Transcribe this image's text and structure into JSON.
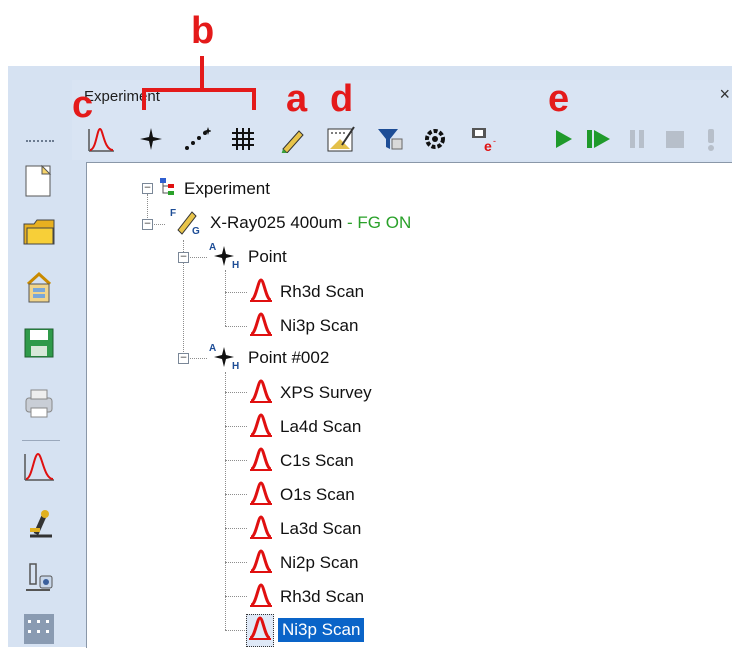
{
  "panel": {
    "title": "Experiment",
    "close_label": "×"
  },
  "annotations": {
    "a": "a",
    "b": "b",
    "c": "c",
    "d": "d",
    "e": "e"
  },
  "colors": {
    "annotation": "#e41a1a",
    "selection": "#0a64c8",
    "status_green": "#2aa12a",
    "peak_red": "#e01010"
  },
  "toolbar": {
    "icons": [
      "spectrum-icon",
      "point-icon",
      "line-icon",
      "grid-icon",
      "pen-icon",
      "image-icon",
      "filter-icon",
      "gear-icon",
      "camera-e-icon",
      "play-icon",
      "step-play-icon",
      "pause-icon",
      "stop-icon",
      "exclamation-icon"
    ]
  },
  "sidebar": {
    "icons": [
      "new-document-icon",
      "open-folder-icon",
      "import-icon",
      "save-icon",
      "print-icon",
      "spectrum-icon",
      "microscope-icon",
      "sample-icon",
      "grid-icon"
    ]
  },
  "tree": {
    "root": {
      "label": "Experiment"
    },
    "source": {
      "label": "X-Ray025 400um",
      "sep": " - ",
      "fg": "FG",
      "on": "ON"
    },
    "point1": {
      "label": "Point",
      "scans": [
        "Rh3d Scan",
        "Ni3p Scan"
      ]
    },
    "point2": {
      "label": "Point #002",
      "scans": [
        "XPS Survey",
        "La4d Scan",
        "C1s Scan",
        "O1s Scan",
        "La3d Scan",
        "Ni2p Scan",
        "Rh3d Scan",
        "Ni3p Scan"
      ]
    },
    "selected": "Ni3p Scan"
  }
}
